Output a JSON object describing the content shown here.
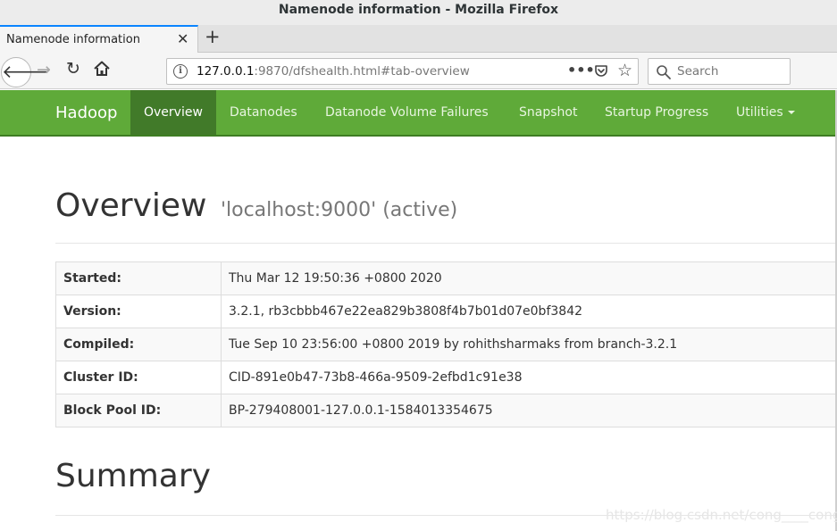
{
  "window": {
    "title": "Namenode information - Mozilla Firefox"
  },
  "tab": {
    "label": "Namenode information",
    "close": "✕",
    "new_tab": "+"
  },
  "nav": {
    "url_host": "127.0.0.1",
    "url_rest": ":9870/dfshealth.html#tab-overview",
    "page_actions": "•••",
    "search_placeholder": "Search"
  },
  "hadoop_nav": {
    "brand": "Hadoop",
    "items": [
      {
        "label": "Overview",
        "active": true
      },
      {
        "label": "Datanodes"
      },
      {
        "label": "Datanode Volume Failures"
      },
      {
        "label": "Snapshot"
      },
      {
        "label": "Startup Progress"
      },
      {
        "label": "Utilities"
      }
    ]
  },
  "overview": {
    "title": "Overview",
    "subtitle": "'localhost:9000' (active)",
    "rows": [
      {
        "key": "Started:",
        "value": "Thu Mar 12 19:50:36 +0800 2020"
      },
      {
        "key": "Version:",
        "value": "3.2.1, rb3cbbb467e22ea829b3808f4b7b01d07e0bf3842"
      },
      {
        "key": "Compiled:",
        "value": "Tue Sep 10 23:56:00 +0800 2019 by rohithsharmaks from branch-3.2.1"
      },
      {
        "key": "Cluster ID:",
        "value": "CID-891e0b47-73b8-466a-9509-2efbd1c91e38"
      },
      {
        "key": "Block Pool ID:",
        "value": "BP-279408001-127.0.0.1-1584013354675"
      }
    ]
  },
  "summary": {
    "title": "Summary"
  },
  "watermark": "https://blog.csdn.net/cong____cong",
  "colors": {
    "navbar": "#5faa39",
    "navbar_active": "#417a29",
    "tab_accent": "#0a84ff"
  }
}
